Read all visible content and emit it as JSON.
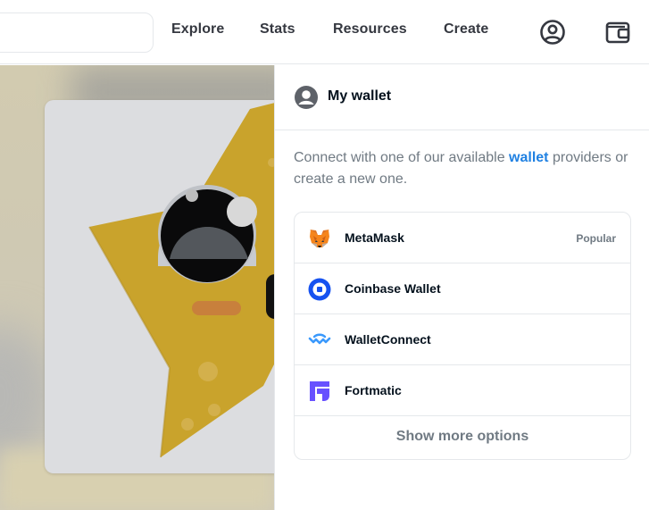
{
  "nav": {
    "links": [
      "Explore",
      "Stats",
      "Resources",
      "Create"
    ],
    "icons": [
      "account-icon",
      "wallet-icon"
    ]
  },
  "panel": {
    "title": "My wallet",
    "intro_prefix": "Connect with one of our available ",
    "intro_highlight": "wallet",
    "intro_suffix": " providers or create a new one.",
    "wallets": [
      {
        "name": "MetaMask",
        "badge": "Popular",
        "icon": "metamask-icon"
      },
      {
        "name": "Coinbase Wallet",
        "badge": "",
        "icon": "coinbase-icon"
      },
      {
        "name": "WalletConnect",
        "badge": "",
        "icon": "walletconnect-icon"
      },
      {
        "name": "Fortmatic",
        "badge": "",
        "icon": "fortmatic-icon"
      }
    ],
    "more_label": "Show more options"
  },
  "colors": {
    "accent": "#2081e2",
    "text": "#04111d",
    "muted": "#707a83",
    "border": "#e5e8eb"
  }
}
